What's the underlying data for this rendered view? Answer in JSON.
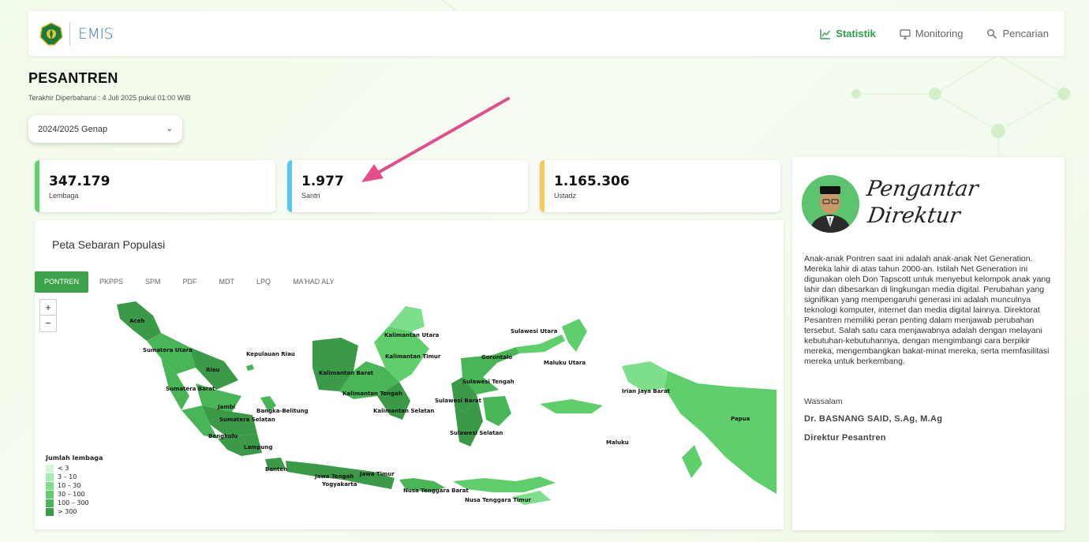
{
  "colors": {
    "accent": "#2e9e4a",
    "card_green": "#5fcf73",
    "card_blue": "#55c7ec",
    "card_yellow": "#f7c95b",
    "arrow": "#e24d8a",
    "legend": [
      "#d6f5d4",
      "#a9eab0",
      "#7dde8b",
      "#5fcf6c",
      "#48b556",
      "#3a9a47"
    ]
  },
  "header": {
    "logo_text": "EMIS",
    "nav": [
      {
        "label": "Statistik",
        "icon": "chart-line-icon",
        "active": true
      },
      {
        "label": "Monitoring",
        "icon": "monitor-icon",
        "active": false
      },
      {
        "label": "Pencarian",
        "icon": "search-icon",
        "active": false
      }
    ]
  },
  "page": {
    "title": "PESANTREN",
    "last_updated": "Terakhir Diperbaharui : 4 Juli 2025 pukul 01:00 WIB",
    "period": "2024/2025 Genap"
  },
  "stats": [
    {
      "value": "347.179",
      "label": "Lembaga"
    },
    {
      "value": "1.977",
      "label": "Santri"
    },
    {
      "value": "1.165.306",
      "label": "Ustadz"
    }
  ],
  "map": {
    "title": "Peta Sebaran Populasi",
    "tabs": [
      "PONTREN",
      "PKPPS",
      "SPM",
      "PDF",
      "MDT",
      "LPQ",
      "MA'HAD ALY"
    ],
    "zoom_in": "+",
    "zoom_out": "−",
    "legend_title": "Jumlah lembaga",
    "legend": [
      "< 3",
      "3 – 10",
      "10 – 30",
      "30 – 100",
      "100 – 300",
      "> 300"
    ],
    "regions": [
      "Aceh",
      "Sumatera Utara",
      "Riau",
      "Kepulauan Riau",
      "Sumatera Barat",
      "Jambi",
      "Bangka-Belitung",
      "Sumatera Selatan",
      "Bengkulu",
      "Lampung",
      "Banten",
      "Jawa Tengah",
      "Jawa Timur",
      "Yogyakarta",
      "Nusa Tenggara Barat",
      "Nusa Tenggara Timur",
      "Kalimantan Utara",
      "Kalimantan Timur",
      "Kalimantan Barat",
      "Kalimantan Tengah",
      "Kalimantan Selatan",
      "Sulawesi Utara",
      "Gorontalo",
      "Maluku Utara",
      "Sulawesi Tengah",
      "Sulawesi Barat",
      "Sulawesi Selatan",
      "Irian Jaya Barat",
      "Papua",
      "Maluku"
    ]
  },
  "director": {
    "heading_line1": "Pengantar",
    "heading_line2": "Direktur",
    "body": "Anak-anak Pontren saat ini adalah anak-anak Net Generation. Mereka lahir di atas tahun 2000-an. Istilah Net Generation ini digunakan oleh Don Tapscott untuk menyebut kelompok anak yang lahir dan dibesarkan di lingkungan media digital. Perubahan yang signifikan yang mempengaruhi generasi ini adalah munculnya teknologi komputer, internet dan media digital lainnya. Direktorat Pesantren memiliki peran penting dalam menjawab perubahan tersebut. Salah satu cara menjawabnya adalah dengan melayani kebutuhan-kebutuhannya, dengan mengimbangi cara berpikir mereka, mengembangkan bakat-minat mereka, serta memfasilitasi mereka untuk berkembang.",
    "closing": "Wassalam",
    "name": "Dr. BASNANG SAID, S.Ag, M.Ag",
    "role": "Direktur Pesantren"
  }
}
